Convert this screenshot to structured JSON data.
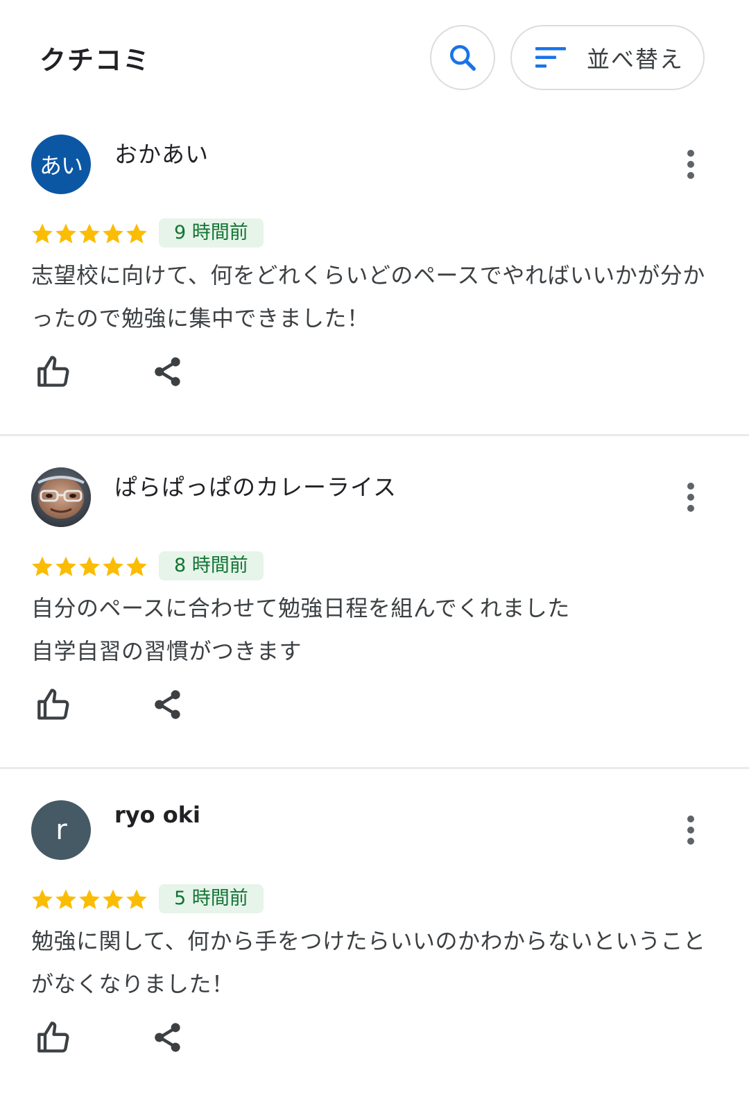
{
  "header": {
    "title": "クチコミ",
    "sort_label": "並べ替え",
    "search_icon": "search-icon",
    "sort_icon": "sort-icon"
  },
  "colors": {
    "accent": "#1a73e8",
    "star": "#fbbc04",
    "badge_bg": "#e6f4ea",
    "badge_text": "#137333",
    "avatar_1": "#0b57a4",
    "avatar_3": "#455a64"
  },
  "reviews": [
    {
      "avatar_text": "あい",
      "name": "おかあい",
      "rating": 5,
      "time": "9 時間前",
      "text_lines": [
        "志望校に向けて、何をどれくらいどのペースでやればいいかが分か",
        "ったので勉強に集中できました！"
      ]
    },
    {
      "avatar_text": "",
      "name": "ぱらぱっぱのカレーライス",
      "rating": 5,
      "time": "8 時間前",
      "text_lines": [
        "自分のペースに合わせて勉強日程を組んでくれました",
        "自学自習の習慣がつきます"
      ]
    },
    {
      "avatar_text": "r",
      "name": "ryo oki",
      "rating": 5,
      "time": "5 時間前",
      "text_lines": [
        "勉強に関して、何から手をつけたらいいのかわからないということ",
        "がなくなりました！"
      ]
    }
  ]
}
